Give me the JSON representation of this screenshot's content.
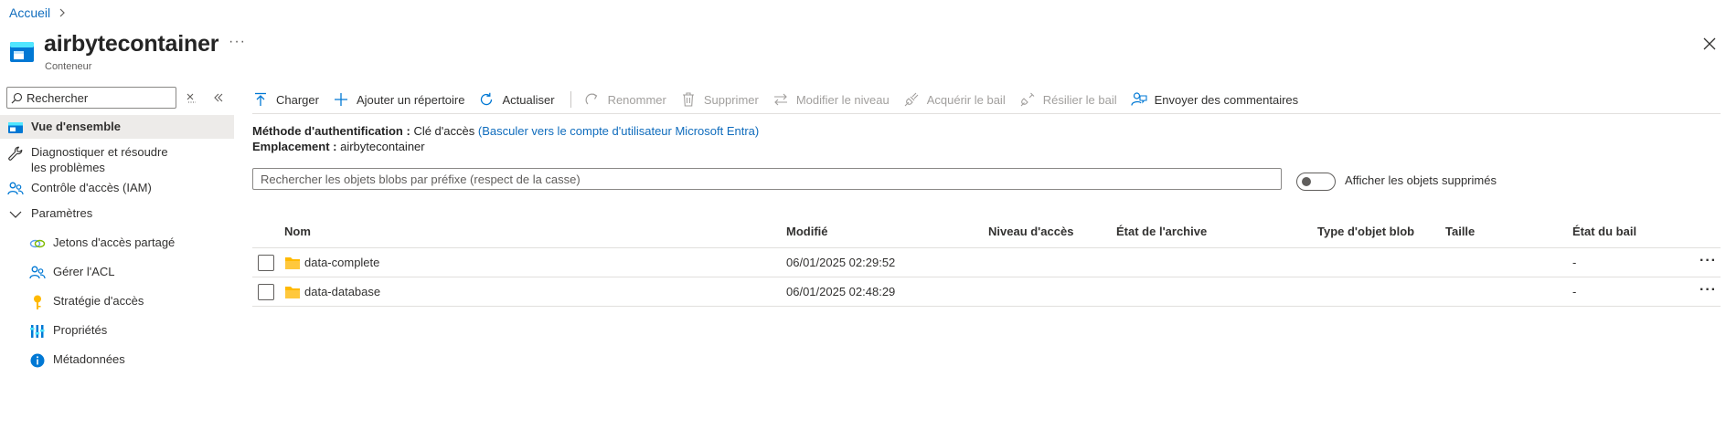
{
  "breadcrumb": {
    "home": "Accueil"
  },
  "header": {
    "title": "airbytecontainer",
    "subtitle": "Conteneur",
    "more": "···"
  },
  "sidebar": {
    "search_placeholder": "Rechercher",
    "items": [
      {
        "label": "Vue d'ensemble",
        "icon": "overview-icon",
        "active": true
      },
      {
        "label": "Diagnostiquer et résoudre les problèmes",
        "icon": "wrench-icon"
      },
      {
        "label": "Contrôle d'accès (IAM)",
        "icon": "people-icon"
      },
      {
        "label": "Paramètres",
        "icon": "chevron-down-icon",
        "expanded": true
      },
      {
        "label": "Jetons d'accès partagé",
        "icon": "link-icon",
        "sub": true
      },
      {
        "label": "Gérer l'ACL",
        "icon": "people-icon",
        "sub": true
      },
      {
        "label": "Stratégie d'accès",
        "icon": "key-icon",
        "sub": true
      },
      {
        "label": "Propriétés",
        "icon": "properties-icon",
        "sub": true
      },
      {
        "label": "Métadonnées",
        "icon": "info-icon",
        "sub": true
      }
    ]
  },
  "toolbar": {
    "upload": "Charger",
    "add_directory": "Ajouter un répertoire",
    "refresh": "Actualiser",
    "rename": "Renommer",
    "delete": "Supprimer",
    "change_tier": "Modifier le niveau",
    "acquire_lease": "Acquérir le bail",
    "break_lease": "Résilier le bail",
    "feedback": "Envoyer des commentaires"
  },
  "info": {
    "auth_label": "Méthode d'authentification :",
    "auth_value": "Clé d'accès",
    "auth_link": "(Basculer vers le compte d'utilisateur Microsoft Entra)",
    "location_label": "Emplacement :",
    "location_value": "airbytecontainer"
  },
  "blob_search": {
    "placeholder": "Rechercher les objets blobs par préfixe (respect de la casse)"
  },
  "show_deleted": {
    "label": "Afficher les objets supprimés",
    "on": false
  },
  "table": {
    "headers": {
      "name": "Nom",
      "modified": "Modifié",
      "access_tier": "Niveau d'accès",
      "archive_status": "État de l'archive",
      "blob_type": "Type d'objet blob",
      "size": "Taille",
      "lease_state": "État du bail"
    },
    "rows": [
      {
        "name": "data-complete",
        "modified": "06/01/2025 02:29:52",
        "access_tier": "",
        "archive_status": "",
        "blob_type": "",
        "size": "",
        "lease_state": "-",
        "more": "···"
      },
      {
        "name": "data-database",
        "modified": "06/01/2025 02:48:29",
        "access_tier": "",
        "archive_status": "",
        "blob_type": "",
        "size": "",
        "lease_state": "-",
        "more": "···"
      }
    ]
  },
  "colors": {
    "accent": "#0f6cbd",
    "folder": "#ffb900",
    "disabled_text": "#a19f9d",
    "active_nav_bg": "#edebe9"
  }
}
